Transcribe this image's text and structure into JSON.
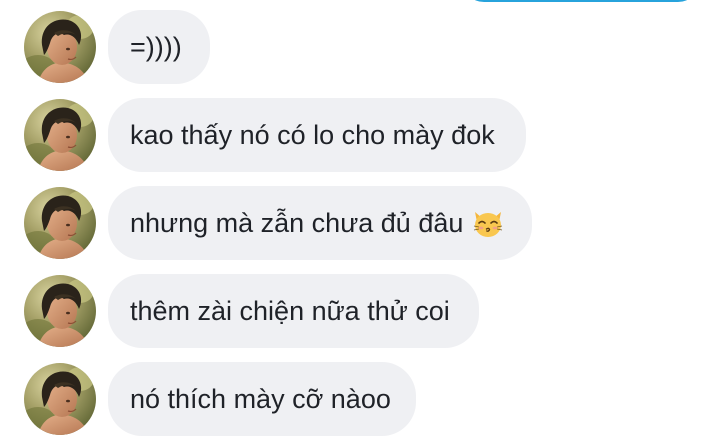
{
  "messages": [
    {
      "text": "=))))"
    },
    {
      "text": "kao thấy nó có lo cho mày đok"
    },
    {
      "text": "nhưng mà zẫn chưa đủ đâu",
      "emoji": "kissing-cat-face-icon"
    },
    {
      "text": "thêm zài chiện nữa thử coi"
    },
    {
      "text": "nó thích mày cỡ nàoo"
    }
  ],
  "colors": {
    "bubble_bg": "#eff0f3",
    "text": "#1f2228",
    "sent_border": "#27a3dc"
  }
}
